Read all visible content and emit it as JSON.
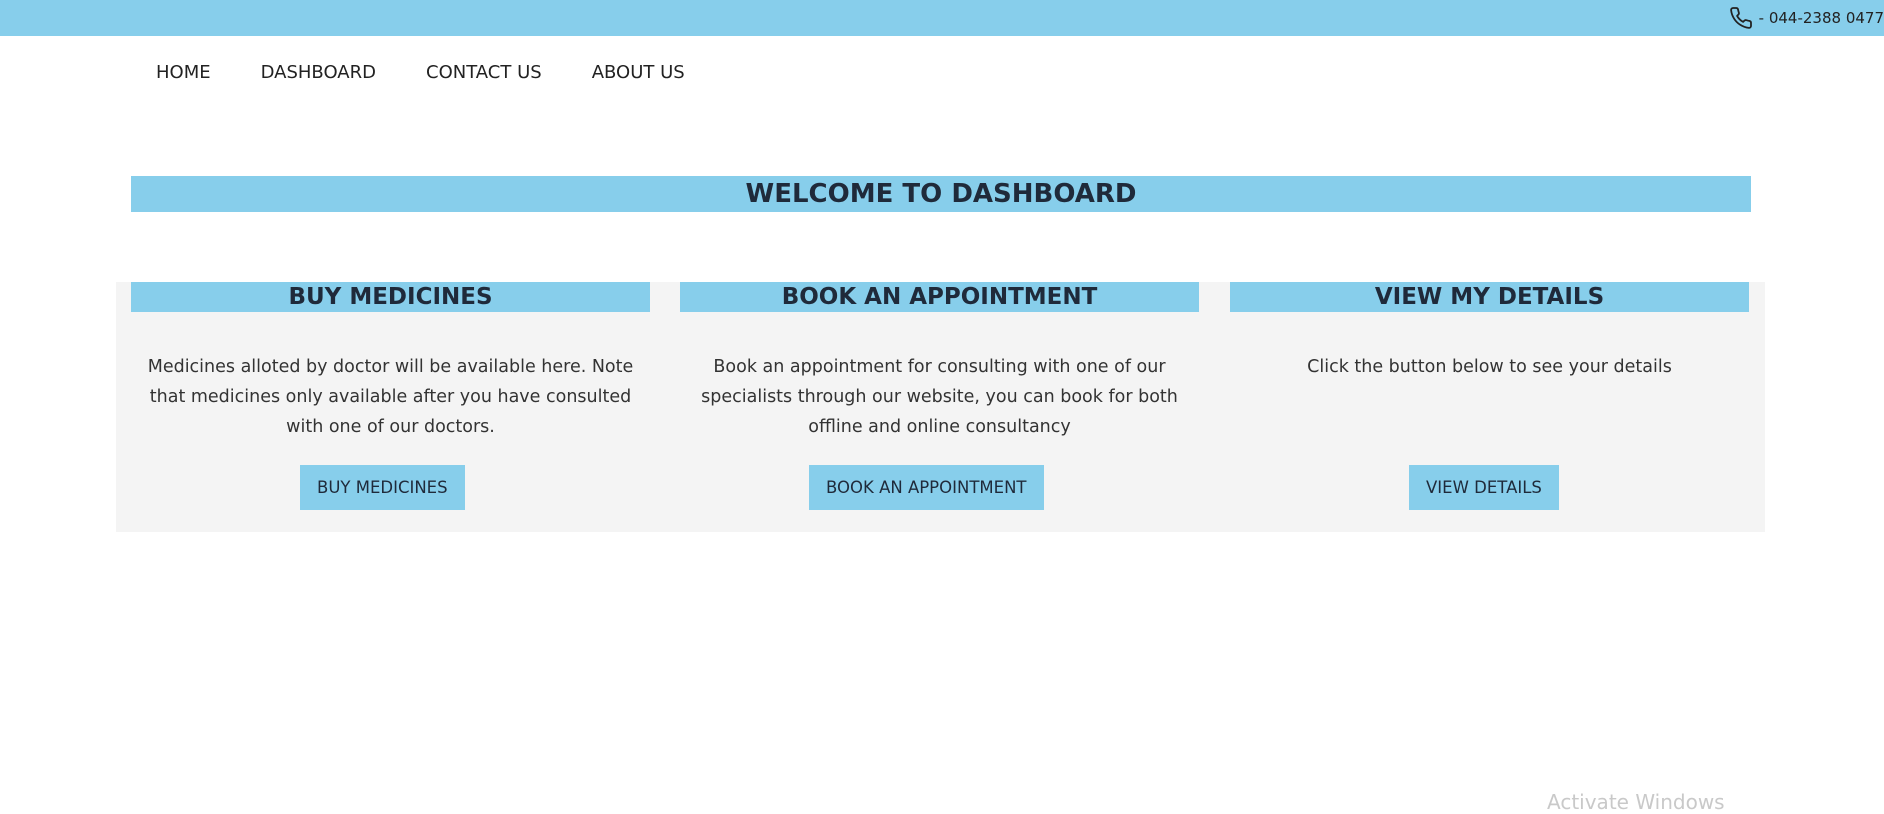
{
  "topbar": {
    "phone_text": "- 044-2388 0477",
    "phone_icon": "phone-icon",
    "color": "#87ceeb"
  },
  "nav": {
    "items": [
      {
        "label": "HOME"
      },
      {
        "label": "DASHBOARD"
      },
      {
        "label": "CONTACT US"
      },
      {
        "label": "ABOUT US"
      }
    ]
  },
  "main": {
    "welcome_title": "WELCOME TO DASHBOARD",
    "cards": [
      {
        "title": "BUY MEDICINES",
        "text": "Medicines alloted by doctor will be available here. Note that medicines only available after you have consulted with one of our doctors.",
        "button": "BUY MEDICINES"
      },
      {
        "title": "BOOK AN APPOINTMENT",
        "text": "Book an appointment for consulting with one of our specialists through our website, you can book for both offline and online consultancy",
        "button": "BOOK AN APPOINTMENT"
      },
      {
        "title": "VIEW MY DETAILS",
        "text": "Click the button below to see your details",
        "button": "VIEW DETAILS"
      }
    ]
  },
  "watermark": "Activate Windows"
}
